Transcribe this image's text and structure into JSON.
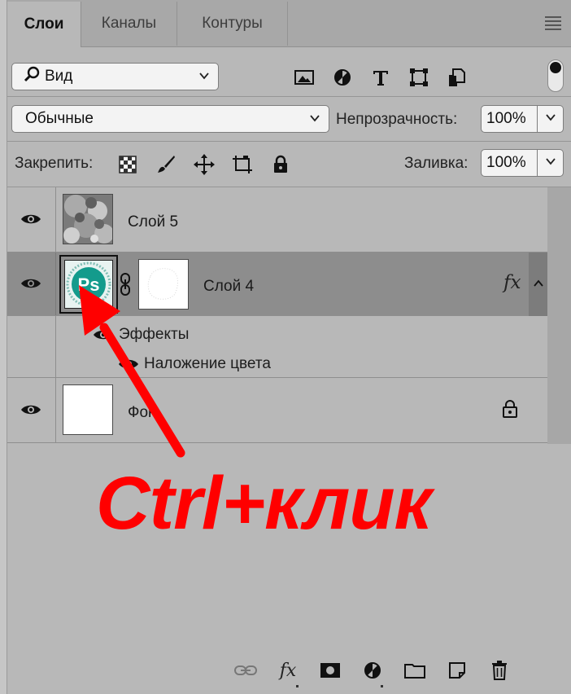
{
  "tabs": [
    {
      "label": "Слои",
      "active": true
    },
    {
      "label": "Каналы",
      "active": false
    },
    {
      "label": "Контуры",
      "active": false
    }
  ],
  "filter": {
    "kind_label": "Вид",
    "icons": [
      "image-filter-icon",
      "adjustment-filter-icon",
      "type-filter-icon",
      "shape-filter-icon",
      "smart-object-filter-icon"
    ]
  },
  "blend": {
    "mode": "Обычные",
    "opacity_label": "Непрозрачность:",
    "opacity_value": "100%"
  },
  "lock": {
    "label": "Закрепить:",
    "icons": [
      "lock-transparent-pixels-icon",
      "lock-image-pixels-icon",
      "lock-position-icon",
      "lock-artboard-icon",
      "lock-all-icon"
    ],
    "fill_label": "Заливка:",
    "fill_value": "100%"
  },
  "layers": [
    {
      "name": "Слой 5",
      "visible": true,
      "selected": false
    },
    {
      "name": "Слой 4",
      "visible": true,
      "selected": true,
      "has_fx": true,
      "fx_label": "fx",
      "effects_label": "Эффекты",
      "effect_items": [
        "Наложение цвета"
      ]
    },
    {
      "name": "Фон",
      "visible": true,
      "selected": false,
      "locked": true
    }
  ],
  "thumb_logo_text": "Ps",
  "annotation": {
    "text": "Ctrl+клик",
    "color": "#ff0000"
  },
  "bottom_toolbar": {
    "fx_label": "fx",
    "icons": [
      "link-layers-icon",
      "add-style-icon",
      "add-mask-icon",
      "new-adjustment-icon",
      "new-group-icon",
      "new-layer-icon",
      "delete-layer-icon"
    ]
  },
  "colors": {
    "panel_bg": "#b8b8b8",
    "selected_row": "#8d8d8d",
    "accent_red": "#ff0000",
    "ps_logo_teal": "#139b8c"
  }
}
